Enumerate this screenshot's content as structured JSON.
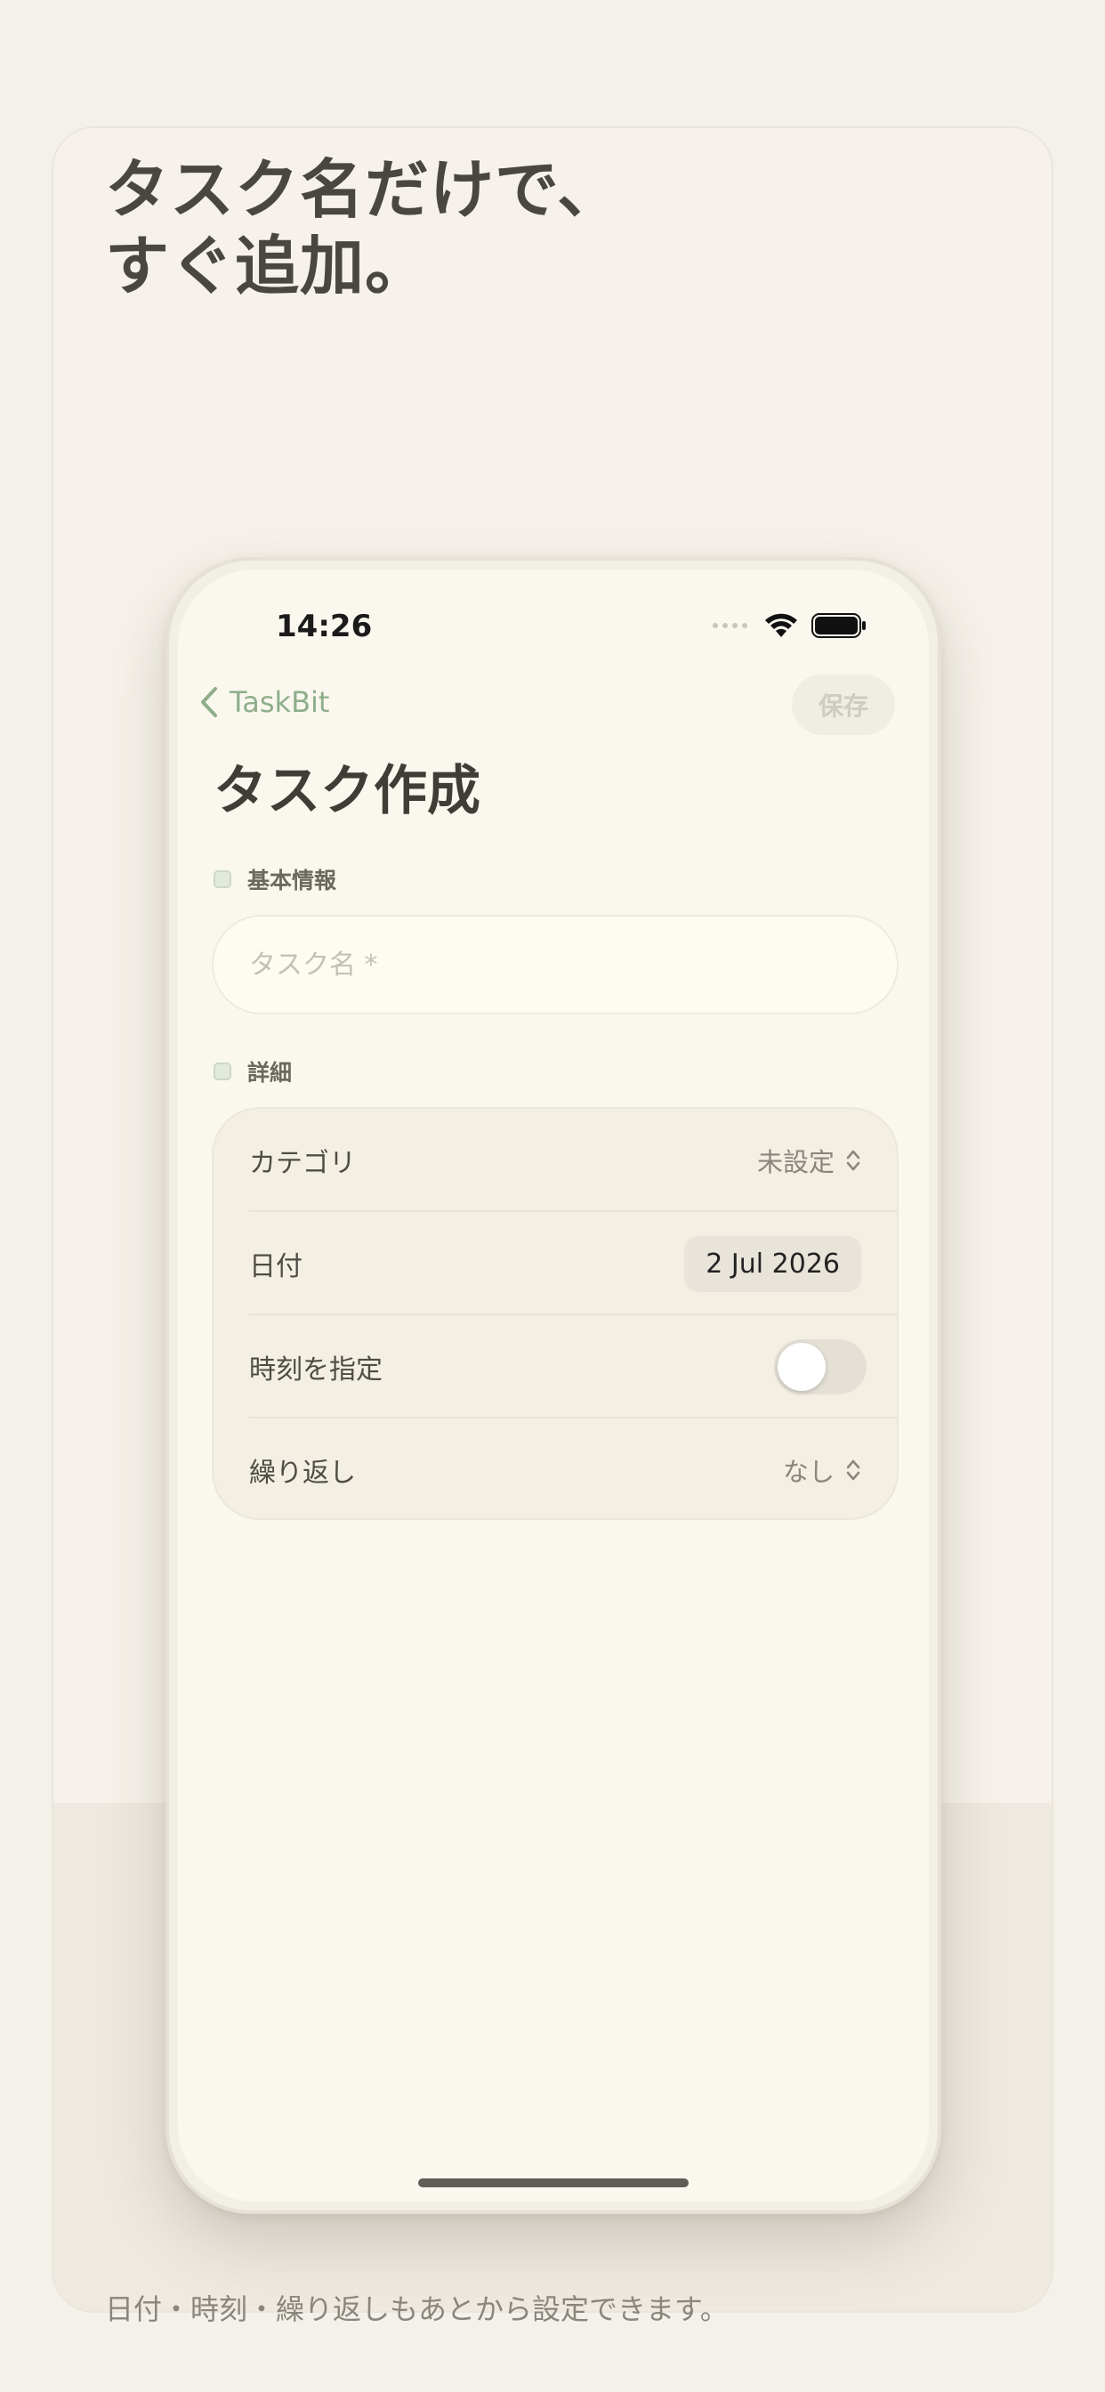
{
  "promo": {
    "headline_line1": "タスク名だけで、",
    "headline_line2": "すぐ追加。",
    "footer": "日付・時刻・繰り返しもあとから設定できます。"
  },
  "status_bar": {
    "time": "14:26",
    "icons": [
      "signal-icon",
      "wifi-icon",
      "battery-icon"
    ]
  },
  "nav": {
    "back_label": "TaskBit",
    "save_label": "保存"
  },
  "page": {
    "title": "タスク作成"
  },
  "basic_info": {
    "section_label": "基本情報",
    "task_name_placeholder": "タスク名 *",
    "task_name_value": ""
  },
  "details": {
    "section_label": "詳細",
    "rows": [
      {
        "label": "カテゴリ",
        "value": "未設定"
      },
      {
        "label": "日付",
        "value": "2 Jul 2026"
      },
      {
        "label": "時刻を指定",
        "toggle_on": false
      },
      {
        "label": "繰り返し",
        "value": "なし"
      }
    ]
  },
  "colors": {
    "accent": "#8fae8c",
    "background": "#faf8ee",
    "text": "#3f3d36"
  }
}
